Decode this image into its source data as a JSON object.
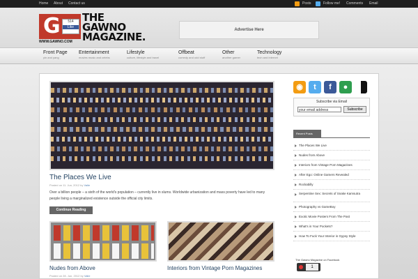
{
  "topbar": {
    "links": [
      "Home",
      "About",
      "Contact us"
    ],
    "right_links": [
      "Posts",
      "Follow me!",
      "Comments",
      "Email"
    ]
  },
  "header": {
    "logo_letter": "G",
    "like_count": "514",
    "like_label": "Like",
    "title_lines": [
      "THE",
      "GAWNO",
      "MAGAZINE."
    ],
    "url": "WWW.GAWNO.COM",
    "ad_text": "Advertise Here"
  },
  "nav": [
    {
      "label": "Front Page",
      "sub": "yin and yang"
    },
    {
      "label": "Entertainment",
      "sub": "movies music and celebs"
    },
    {
      "label": "Lifestyle",
      "sub": "culture, lifestyle and travel"
    },
    {
      "label": "Offbeat",
      "sub": "comedy and odd stuff"
    },
    {
      "label": "Other",
      "sub": "another gamer"
    },
    {
      "label": "Technology",
      "sub": "tech and internet"
    }
  ],
  "featured": {
    "title": "The Places We Live",
    "meta_prefix": "Posted on 11. Jun, 2012 by",
    "author": "Valie",
    "excerpt": "Over a billion people – a sixth of the world's population – currently live in slums. Worldwide urbanization and mass poverty have led to many people living a marginalized existence outside the official city limits.",
    "button": "Continue Reading"
  },
  "posts": [
    {
      "title": "Nudes from Above",
      "meta_prefix": "Posted on 28. Jun, 2012 by",
      "author": "Valie"
    },
    {
      "title": "Interiors from Vintage Porn Magazines",
      "meta_prefix": "",
      "author": ""
    }
  ],
  "sidebar": {
    "social_icons": [
      "rss-icon",
      "twitter-icon",
      "facebook-icon",
      "chat-icon",
      "delicious-icon"
    ],
    "subscribe_label": "Subscribe via Email",
    "subscribe_value": "your email address",
    "subscribe_button": "Subscribe",
    "recent_heading": "Recent Posts",
    "recent": [
      "The Places We Live",
      "Nudes from Above",
      "Interiors from Vintage Porn Magazines",
      "After Ego: Online Gamers Revealed",
      "Rockabilly",
      "Serpentine Sex: Secrets of Snake Kamsutra",
      "Photography vs GameBoy",
      "Exotic Movie Posters From The Past",
      "What's in Your Pockets?",
      "How To Fuck Your Interior in Gypsy Style"
    ],
    "fb_title": "The Gawno Magazine on Facebook",
    "fb_count": "1"
  },
  "colors": {
    "brand_red": "#c0392b",
    "facebook_blue": "#3b5998",
    "twitter_blue": "#55acee",
    "title_blue": "#1f3f5f"
  }
}
